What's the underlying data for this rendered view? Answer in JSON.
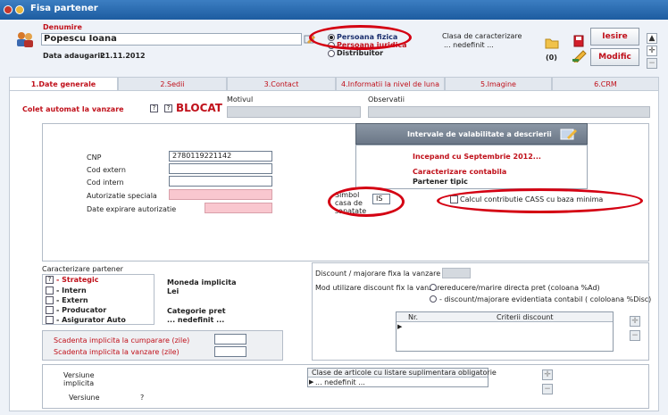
{
  "window": {
    "title": "Fisa partener"
  },
  "header": {
    "denumire_label": "Denumire",
    "name_value": "Popescu Ioana",
    "date_label": "Data adaugarii:",
    "date_value": "21.11.2012",
    "radio_fizica": "Persoana fizica",
    "radio_juridica": "Persoana juridica",
    "radio_distribuitor": "Distribuitor",
    "clasa_label": "Clasa de caracterizare",
    "clasa_value": "... nedefinit ...",
    "attach_count": "(0)",
    "iesire_button": "Iesire",
    "modific_button": "Modific"
  },
  "tabs": [
    "1.Date generale",
    "2.Sedii",
    "3.Contact",
    "4.Informatii la nivel de luna",
    "5.Imagine",
    "6.CRM"
  ],
  "general": {
    "colet_label": "Colet automat la vanzare",
    "help_mark": "?",
    "blocat_label": "BLOCAT",
    "motivul_label": "Motivul",
    "observatii_label": "Observatii",
    "cnp_label": "CNP",
    "cnp_value": "2780119221142",
    "cod_extern_label": "Cod extern",
    "cod_intern_label": "Cod intern",
    "autorizatie_label": "Autorizatie speciala",
    "data_expirare_label": "Date expirare autorizatie"
  },
  "validity": {
    "title": "Intervale de valabilitate a descrierii",
    "incepand": "Incepand cu Septembrie 2012...",
    "caracterizare_contabila": "Caracterizare contabila",
    "partener_tipic": "Partener tipic",
    "simbol_label": "Simbol casa de sanatate",
    "simbol_value": "IS",
    "cass_label": "Calcul contributie CASS cu baza minima"
  },
  "caracterizare": {
    "title": "Caracterizare partener",
    "items": [
      "- Strategic",
      "- Intern",
      "- Extern",
      "- Producator",
      "- Asigurator Auto"
    ],
    "moneda_label": "Moneda implicita",
    "moneda_value": "Lei",
    "categorie_label": "Categorie pret",
    "categorie_value": "... nedefinit ...",
    "scadenta_cumparare": "Scadenta implicita la cumparare (zile)",
    "scadenta_vanzare": "Scadenta implicita la vanzare (zile)"
  },
  "discount": {
    "fixa_label": "Discount / majorare fixa la vanzare (%)",
    "mod_label": "Mod utilizare discount fix la vanzare",
    "option1": "- reducere/marire directa pret (coloana %Ad)",
    "option2": "- discount/majorare evidentiata contabil ( cololoana %Disc)",
    "col_nr": "Nr.",
    "col_criterii": "Criterii discount"
  },
  "versiune": {
    "implicite_label1": "Versiune",
    "implicite_label2": "implicita",
    "versiune_label": "Versiune",
    "versiune_value": "?",
    "clase_header": "Clase de articole cu listare suplimentara obligatorie",
    "clase_value": "... nedefinit ..."
  },
  "colors": {
    "accent": "#c0101a",
    "titlebar": "#2a6db3",
    "annotation": "#d40012"
  }
}
